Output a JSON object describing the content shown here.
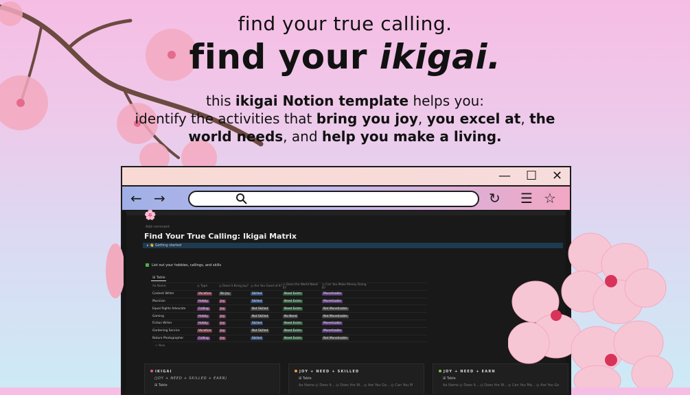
{
  "hero": {
    "tagline": "find your true calling.",
    "headline_prefix": "find your ",
    "headline_em": "ikigai.",
    "desc_line1_a": "this ",
    "desc_line1_b": "ikigai Notion template",
    "desc_line1_c": " helps you:",
    "desc_line2_a": "identify the activities that ",
    "desc_line2_b": "bring you joy",
    "desc_line2_c": ", ",
    "desc_line2_d": "you excel at",
    "desc_line2_e": ", ",
    "desc_line2_f": "the",
    "desc_line3_a": "world needs",
    "desc_line3_b": ", and ",
    "desc_line3_c": "help you make a living."
  },
  "window_controls": {
    "minimize": "—",
    "maximize": "☐",
    "close": "✕"
  },
  "nav": {
    "back": "←",
    "forward": "→",
    "reload": "↻",
    "menu": "☰",
    "bookmark": "☆"
  },
  "notion": {
    "page_icon": "🌸",
    "meta": "Add comment",
    "title": "Find Your True Calling: Ikigai Matrix",
    "callout": "▸  👋 Getting started",
    "task": "List out your hobbies, callings, and skills",
    "tab_label": "⊞ Table",
    "columns": [
      "Aa Name",
      "◎ Type",
      "◎ Does It Bring Joy?",
      "◎ Are You Good at It?",
      "◎ Does the World Need It?",
      "◎ Can You Make Money Doing It?"
    ],
    "rows": [
      {
        "name": "Content Writer",
        "type": "Vocation",
        "joy": "No Joy",
        "good": "Skilled",
        "need": "Need Exists",
        "money": "Monetizable"
      },
      {
        "name": "Musician",
        "type": "Hobby",
        "joy": "Joy",
        "good": "Skilled",
        "need": "Need Exists",
        "money": "Monetizable"
      },
      {
        "name": "Equal Rights Advocate",
        "type": "Calling",
        "joy": "Joy",
        "good": "Not Skilled",
        "need": "Need Exists",
        "money": "Not Monetizable"
      },
      {
        "name": "Gaming",
        "type": "Hobby",
        "joy": "Joy",
        "good": "Not Skilled",
        "need": "No Need",
        "money": "Not Monetizable"
      },
      {
        "name": "Fiction Writer",
        "type": "Hobby",
        "joy": "Joy",
        "good": "Skilled",
        "need": "Need Exists",
        "money": "Monetizable"
      },
      {
        "name": "Gardening Service",
        "type": "Vocation",
        "joy": "Joy",
        "good": "Not Skilled",
        "need": "Need Exists",
        "money": "Monetizable"
      },
      {
        "name": "Nature Photographer",
        "type": "Calling",
        "joy": "Joy",
        "good": "Skilled",
        "need": "Need Exists",
        "money": "Not Monetizable"
      }
    ],
    "new_row": "+ New",
    "cards": [
      {
        "title": "IKIGAI",
        "subtitle": "(JOY + NEED + SKILLED + EARN)",
        "tab": "⊞ Table",
        "header": "",
        "dot": "#e05a7a"
      },
      {
        "title": "JOY + NEED + SKILLED",
        "subtitle": "",
        "tab": "⊞ Table",
        "header": "Aa Name   ◎ Does It...   ◎ Does the W...   ◎ Are You Go...   ◎ Can You M",
        "dot": "#e8a23a"
      },
      {
        "title": "JOY + NEED + EARN",
        "subtitle": "",
        "tab": "⊞ Table",
        "header": "Aa Name   ◎ Does It...   ◎ Does the W...   ◎ Can You Ma...   ◎ Are You Go",
        "dot": "#8bc34a"
      }
    ]
  }
}
